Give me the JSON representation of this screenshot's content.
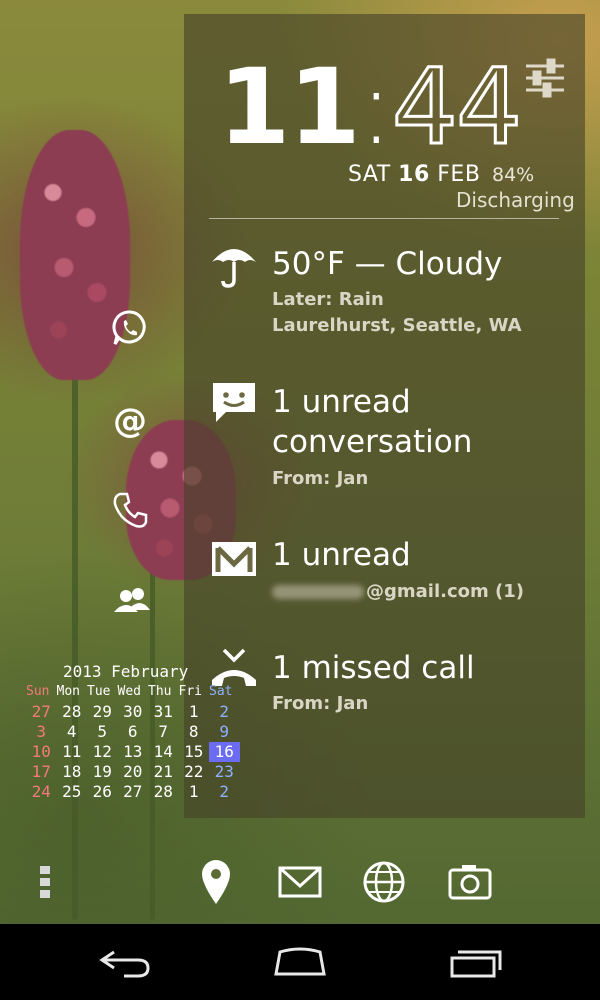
{
  "clock": {
    "hours": "11",
    "separator": ":",
    "minutes": "44"
  },
  "date": {
    "weekday": "SAT",
    "day": "16",
    "month": "FEB"
  },
  "battery": {
    "percent": "84%",
    "status": "Discharging"
  },
  "weather": {
    "headline": "50°F — Cloudy",
    "later": "Later: Rain",
    "location": "Laurelhurst, Seattle, WA"
  },
  "messages": {
    "line1": "1 unread",
    "line2": "conversation",
    "from": "From: Jan"
  },
  "gmail": {
    "headline": "1 unread",
    "account_suffix": "@gmail.com (1)"
  },
  "missed_call": {
    "headline": "1 missed call",
    "from": "From: Jan"
  },
  "calendar": {
    "title": "2013 February",
    "weekdays": [
      "Sun",
      "Mon",
      "Tue",
      "Wed",
      "Thu",
      "Fri",
      "Sat"
    ],
    "weeks": [
      [
        "27",
        "28",
        "29",
        "30",
        "31",
        "1",
        "2"
      ],
      [
        "3",
        "4",
        "5",
        "6",
        "7",
        "8",
        "9"
      ],
      [
        "10",
        "11",
        "12",
        "13",
        "14",
        "15",
        "16"
      ],
      [
        "17",
        "18",
        "19",
        "20",
        "21",
        "22",
        "23"
      ],
      [
        "24",
        "25",
        "26",
        "27",
        "28",
        "1",
        "2"
      ]
    ],
    "today": "16"
  },
  "shortcuts": [
    "whatsapp-icon",
    "at-sign-icon",
    "phone-icon",
    "contacts-icon"
  ],
  "dock": [
    "app-drawer-icon",
    "maps-pin-icon",
    "email-icon",
    "browser-globe-icon",
    "camera-icon"
  ],
  "colors": {
    "sunday": "#f37a7a",
    "saturday": "#8fb0ff",
    "today_highlight": "#6b6cf2",
    "panel": "rgba(70,66,40,0.62)"
  }
}
